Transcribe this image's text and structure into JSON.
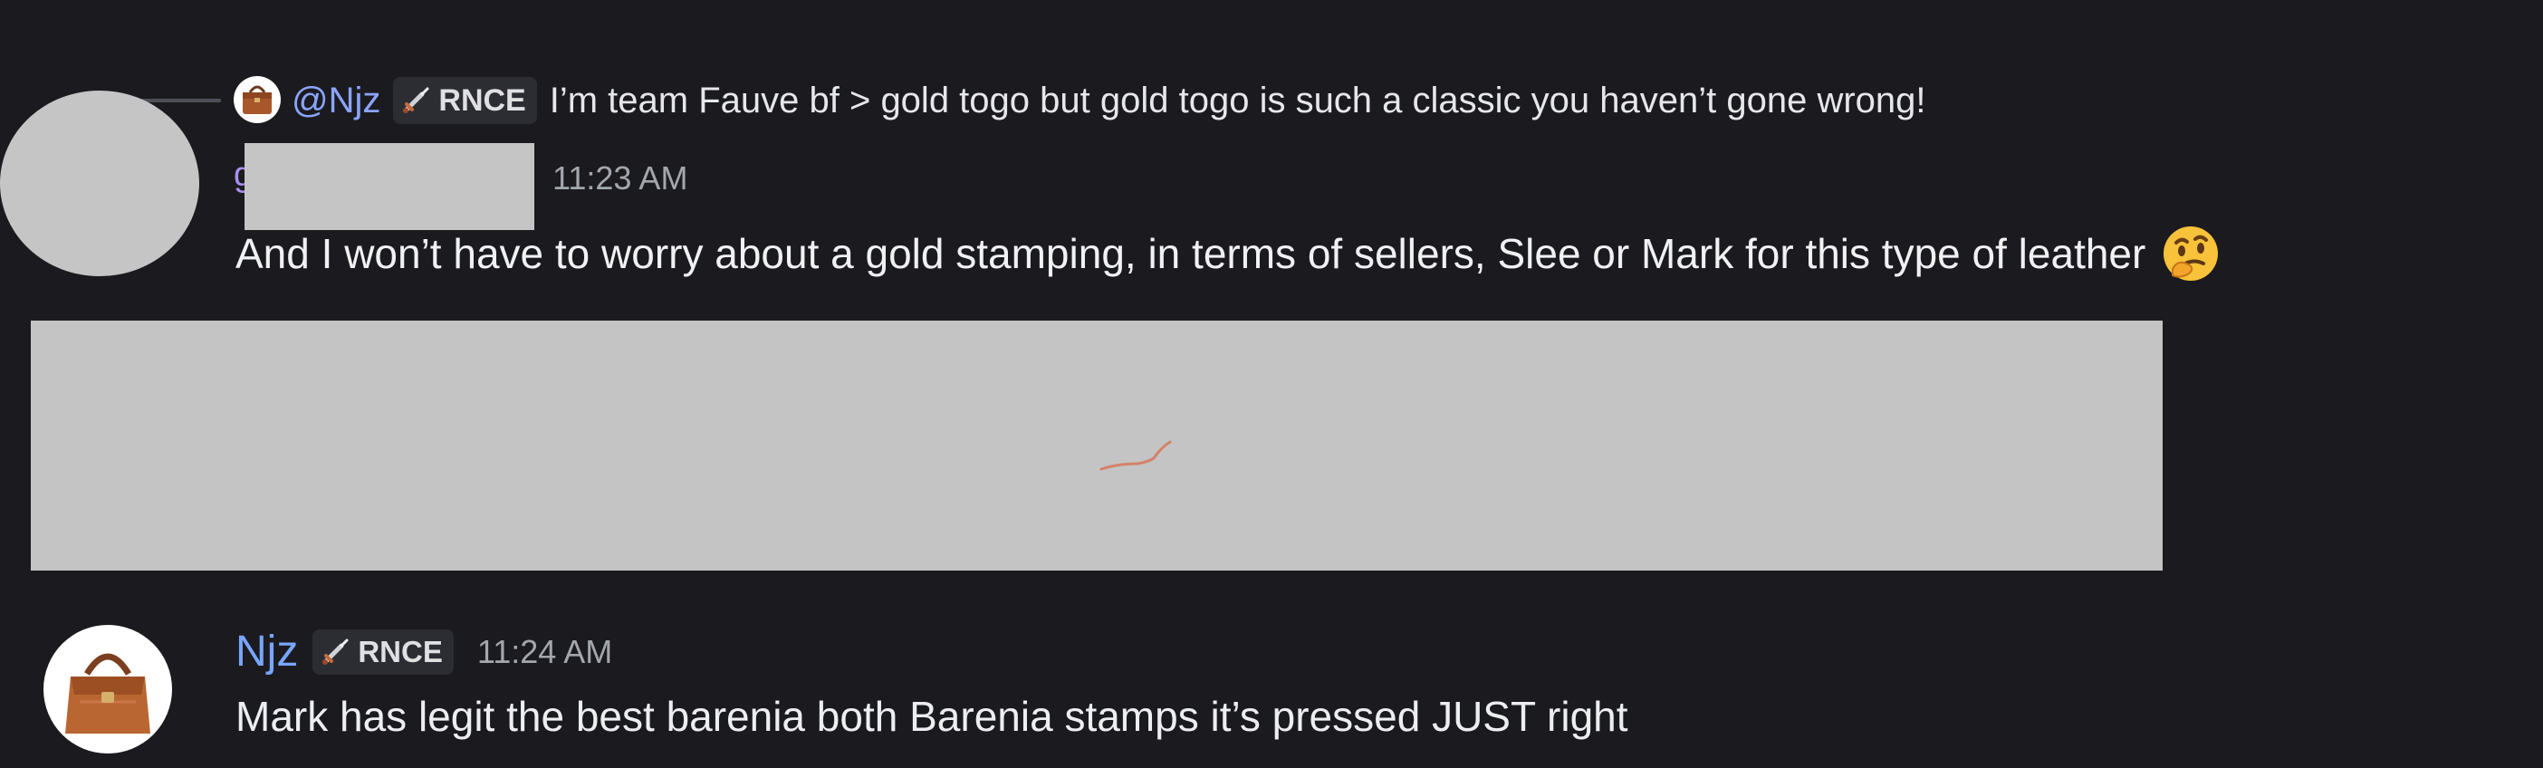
{
  "reply": {
    "mention": "@Njz",
    "role_tag": "RNCE",
    "text": "I’m team Fauve bf > gold togo but gold togo is such a classic you haven’t gone wrong!"
  },
  "message_1": {
    "author_initial": "g",
    "timestamp": "11:23 AM",
    "text": "And I won’t have to worry about a gold stamping, in terms of sellers, Slee or Mark for this type of leather",
    "emoji": "thinking-face"
  },
  "message_2": {
    "author": "Njz",
    "role_tag": "RNCE",
    "timestamp": "11:24 AM",
    "text": "Mark has legit the best barenia both Barenia stamps it’s pressed JUST right"
  },
  "colors": {
    "background": "#1b1b1f",
    "mention": "#8ba4ff",
    "username": "#78a6ff",
    "timestamp": "#a3a6ad",
    "redaction": "#c5c5c5"
  }
}
